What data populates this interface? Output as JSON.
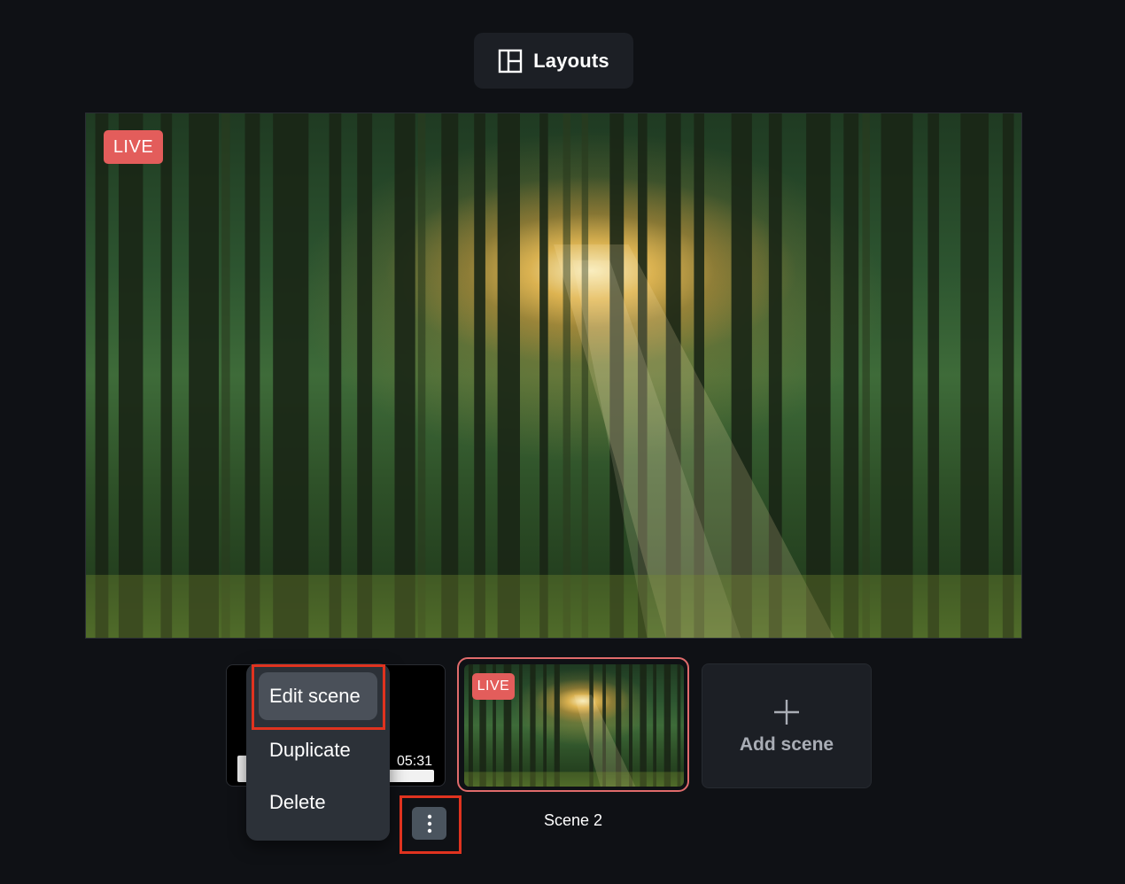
{
  "toolbar": {
    "layouts_label": "Layouts",
    "layouts_icon": "layout-icon"
  },
  "preview": {
    "live_badge": "LIVE",
    "image": "forest-sunlight-scene"
  },
  "scenes": [
    {
      "timer": "05:31",
      "menu": {
        "items": [
          "Edit scene",
          "Duplicate",
          "Delete"
        ],
        "highlighted": "Edit scene"
      },
      "more_icon": "more-vertical-icon"
    },
    {
      "label": "Scene 2",
      "live_badge": "LIVE",
      "image": "forest-sunlight-scene"
    }
  ],
  "add_scene": {
    "label": "Add scene",
    "icon": "plus-icon"
  },
  "colors": {
    "background": "#0f1115",
    "panel": "#1c1f25",
    "live_badge": "#e35d5b",
    "live_frame": "#e06b6b",
    "highlight": "#e0331f",
    "menu_bg": "#2c3138",
    "menu_item_active": "#4a5059"
  }
}
